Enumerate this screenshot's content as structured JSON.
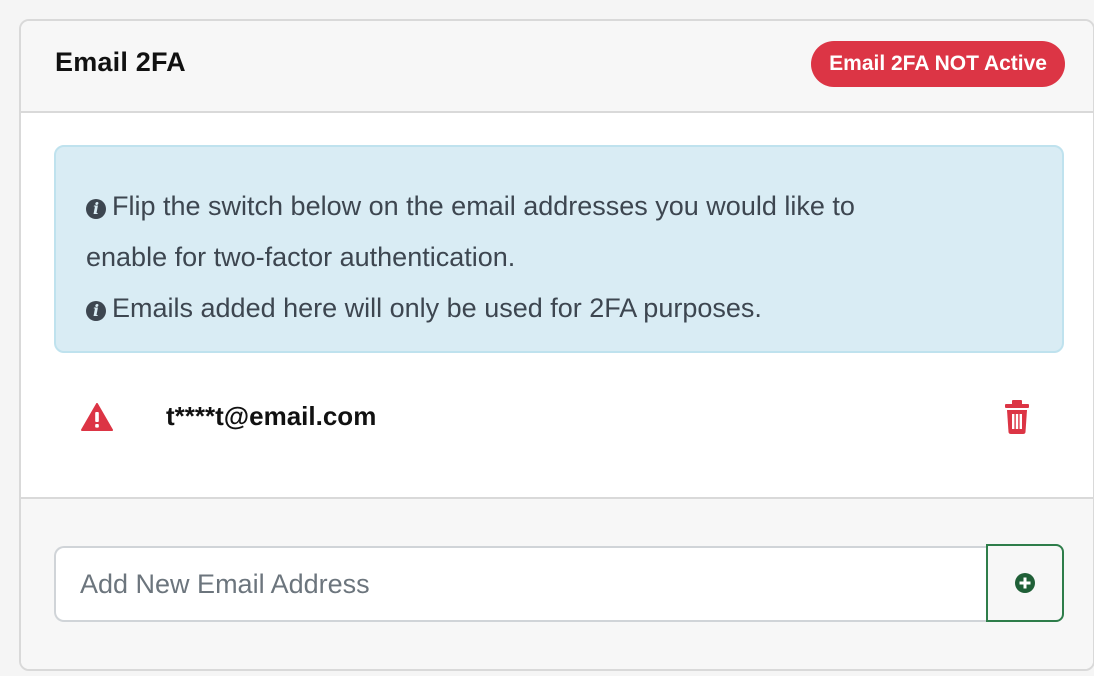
{
  "card": {
    "title": "Email 2FA",
    "status_badge": "Email 2FA NOT Active"
  },
  "info_alert": {
    "line1": "Flip the switch below on the email addresses you would like to",
    "line1b": "enable for two-factor authentication.",
    "line2": "Emails added here will only be used for 2FA purposes."
  },
  "emails": [
    {
      "address": "t****t@email.com",
      "status_icon": "warning-icon",
      "action_icon": "trash-icon"
    }
  ],
  "add_email": {
    "placeholder": "Add New Email Address",
    "button_icon": "plus-circle-icon"
  },
  "colors": {
    "danger": "#dc3545",
    "success": "#2e7d4a",
    "info_bg": "#d9ecf4",
    "info_border": "#bfe2ee"
  }
}
